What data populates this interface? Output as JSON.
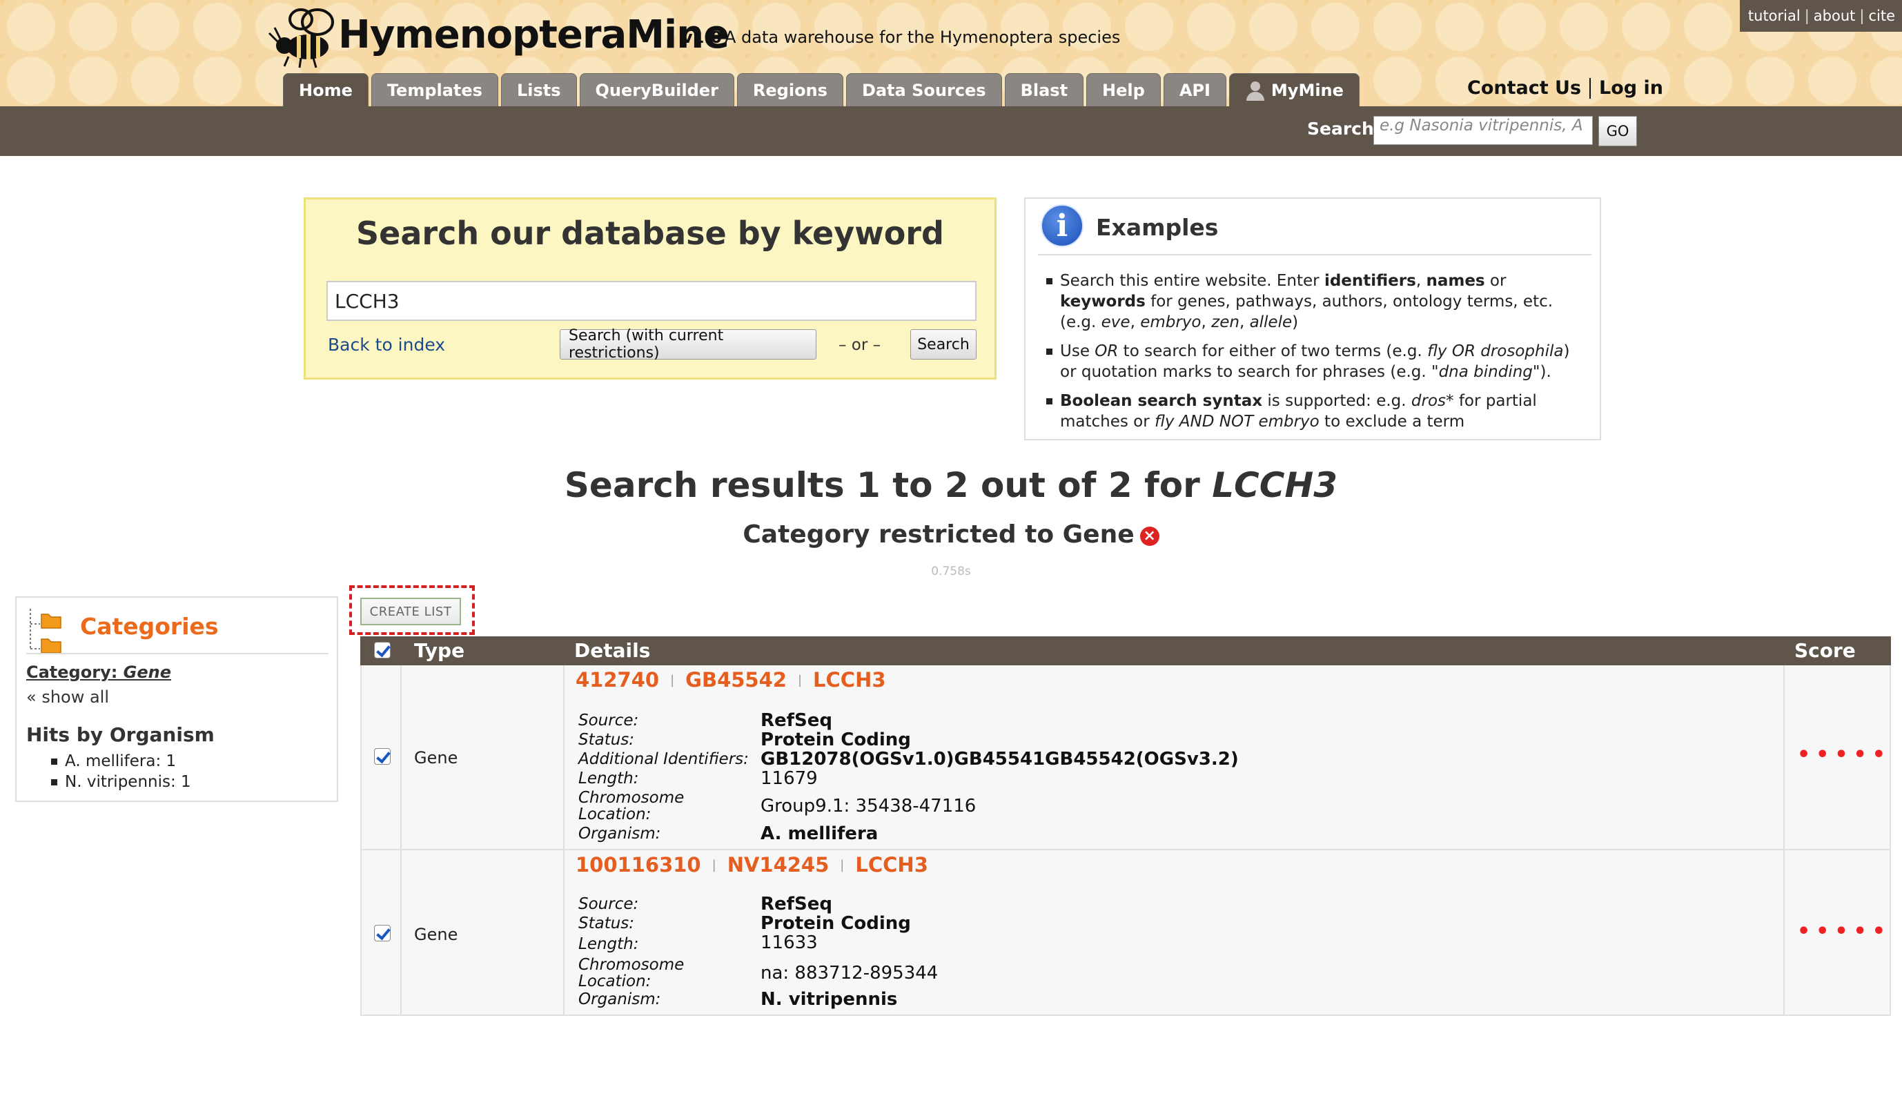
{
  "header": {
    "site_name": "HymenopteraMine",
    "version": "v1.0",
    "tagline": "A data warehouse for the Hymenoptera species",
    "top_links": [
      "tutorial",
      "about",
      "cite"
    ],
    "tabs": [
      "Home",
      "Templates",
      "Lists",
      "QueryBuilder",
      "Regions",
      "Data Sources",
      "Blast",
      "Help",
      "API",
      "MyMine"
    ],
    "active_tab": "Home",
    "contact_label": "Contact Us",
    "login_label": "Log in",
    "search_label": "Search:",
    "search_placeholder": "e.g  Nasonia vitripennis, A",
    "go_label": "GO"
  },
  "keyword_search": {
    "title": "Search our database by keyword",
    "value": "LCCH3",
    "back_link": "Back to index",
    "search_restrict_label": "Search (with current restrictions)",
    "or_text": "– or –",
    "search_label": "Search"
  },
  "examples": {
    "title": "Examples",
    "items": [
      {
        "parts": [
          [
            "Search this entire website. Enter ",
            "n"
          ],
          [
            "identifiers",
            "b"
          ],
          [
            ", ",
            "n"
          ],
          [
            "names",
            "b"
          ],
          [
            " or ",
            "n"
          ],
          [
            "keywords",
            "b"
          ],
          [
            " for genes, pathways, authors, ontology terms, etc. (e.g. ",
            "n"
          ],
          [
            "eve",
            "i"
          ],
          [
            ", ",
            "n"
          ],
          [
            "embryo",
            "i"
          ],
          [
            ", ",
            "n"
          ],
          [
            "zen",
            "i"
          ],
          [
            ", ",
            "n"
          ],
          [
            "allele",
            "i"
          ],
          [
            ")",
            "n"
          ]
        ]
      },
      {
        "parts": [
          [
            "Use ",
            "n"
          ],
          [
            "OR",
            "i"
          ],
          [
            " to search for either of two terms (e.g. ",
            "n"
          ],
          [
            "fly OR drosophila",
            "i"
          ],
          [
            ") or quotation marks to search for phrases (e.g. ",
            "n"
          ],
          [
            "\"dna binding\"",
            "i"
          ],
          [
            ").",
            "n"
          ]
        ]
      },
      {
        "parts": [
          [
            "Boolean search syntax",
            "b"
          ],
          [
            " is supported: e.g. ",
            "n"
          ],
          [
            "dros*",
            "i"
          ],
          [
            " for partial matches or ",
            "n"
          ],
          [
            "fly AND NOT embryo",
            "i"
          ],
          [
            " to exclude a term",
            "n"
          ]
        ]
      }
    ]
  },
  "results": {
    "heading_prefix": "Search results 1 to 2 out of 2 for ",
    "query": "LCCH3",
    "category_heading": "Category restricted to Gene",
    "timing": "0.758s",
    "create_list_label": "CREATE LIST",
    "columns": [
      "Type",
      "Details",
      "Score"
    ],
    "rows": [
      {
        "type": "Gene",
        "ids": [
          "412740",
          "GB45542",
          "LCCH3"
        ],
        "fields": [
          {
            "label": "Source:",
            "value": "RefSeq",
            "bold": true
          },
          {
            "label": "Status:",
            "value": "Protein Coding",
            "bold": true
          },
          {
            "label": "Additional Identifiers:",
            "value": "GB12078(OGSv1.0)GB45541GB45542(OGSv3.2)",
            "bold": true
          },
          {
            "label": "Length:",
            "value": "11679",
            "bold": false
          },
          {
            "label": "Chromosome Location:",
            "value": "Group9.1: 35438-47116",
            "bold": false
          },
          {
            "label": "Organism:",
            "value": "A. mellifera",
            "bold": true
          }
        ],
        "score": "•••••"
      },
      {
        "type": "Gene",
        "ids": [
          "100116310",
          "NV14245",
          "LCCH3"
        ],
        "fields": [
          {
            "label": "Source:",
            "value": "RefSeq",
            "bold": true
          },
          {
            "label": "Status:",
            "value": "Protein Coding",
            "bold": true
          },
          {
            "label": "Length:",
            "value": "11633",
            "bold": false
          },
          {
            "label": "Chromosome Location:",
            "value": "na: 883712-895344",
            "bold": false
          },
          {
            "label": "Organism:",
            "value": "N. vitripennis",
            "bold": true
          }
        ],
        "score": "•••••"
      }
    ]
  },
  "sidebar": {
    "title": "Categories",
    "category_prefix": "Category: ",
    "category_value": "Gene",
    "show_all": "« show all",
    "hits_title": "Hits by Organism",
    "hits": [
      "A. mellifera: 1",
      "N. vitripennis: 1"
    ]
  },
  "colors": {
    "brand_brown": "#5f554b",
    "accent_orange": "#e55e20",
    "keyword_box_bg": "#fcf7c2",
    "score_red": "#ee2222"
  }
}
